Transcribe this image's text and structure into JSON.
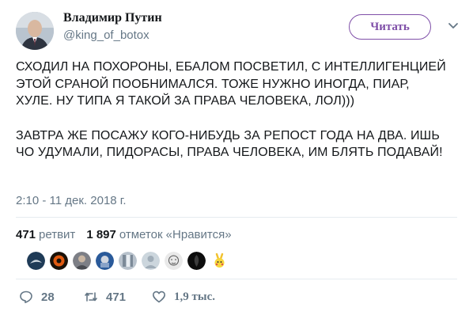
{
  "header": {
    "display_name": "Владимир Путин",
    "handle": "@king_of_botox",
    "follow_label": "Читать"
  },
  "tweet": {
    "paragraph_1": "СХОДИЛ НА ПОХОРОНЫ, ЕБАЛОМ ПОСВЕТИЛ, С ИНТЕЛЛИГЕНЦИЕЙ ЭТОЙ СРАНОЙ ПООБНИМАЛСЯ. ТОЖЕ НУЖНО ИНОГДА, ПИАР, ХУЛЕ. НУ ТИПА Я ТАКОЙ ЗА ПРАВА ЧЕЛОВЕКА, ЛОЛ)))",
    "paragraph_2": "ЗАВТРА ЖЕ ПОСАЖУ КОГО-НИБУДЬ ЗА РЕПОСТ ГОДА НА ДВА. ИШЬ ЧО УДУМАЛИ, ПИДОРАСЫ, ПРАВА ЧЕЛОВЕКА, ИМ БЛЯТЬ ПОДАВАЙ!",
    "timestamp": "2:10 - 11 дек. 2018 г."
  },
  "stats": {
    "retweets_count": "471",
    "retweets_label": "ретвит",
    "likes_count": "1 897",
    "likes_label": "отметок «Нравится»"
  },
  "likers": [
    {
      "icon": "avatar"
    },
    {
      "icon": "avatar"
    },
    {
      "icon": "avatar"
    },
    {
      "icon": "avatar"
    },
    {
      "icon": "avatar"
    },
    {
      "icon": "avatar"
    },
    {
      "icon": "avatar"
    },
    {
      "icon": "avatar"
    },
    {
      "icon": "avatar"
    }
  ],
  "actions": {
    "replies": "28",
    "retweets": "471",
    "likes": "1,9 тыс."
  },
  "colors": {
    "accent": "#7f4fa8",
    "text": "#14171a",
    "muted": "#657786",
    "divider": "#e6ecf0"
  }
}
